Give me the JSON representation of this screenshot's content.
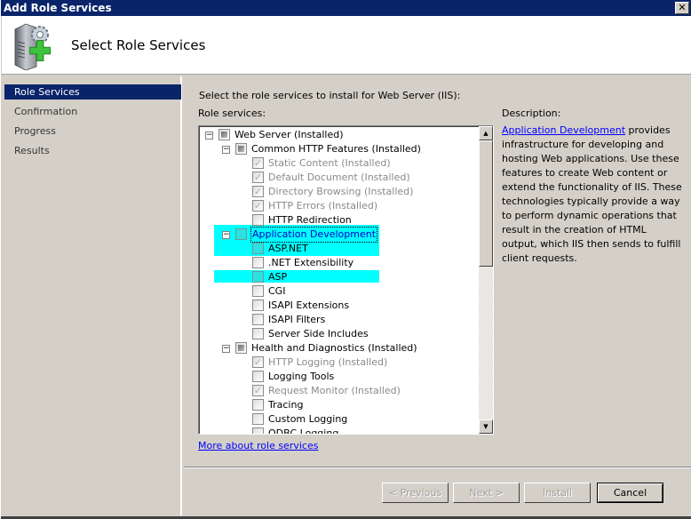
{
  "window": {
    "title": "Add Role Services",
    "close_icon": "close-x-icon"
  },
  "header": {
    "title": "Select Role Services",
    "icon": "server-add-icon"
  },
  "sidebar": {
    "items": [
      {
        "label": "Role Services",
        "active": true
      },
      {
        "label": "Confirmation",
        "active": false
      },
      {
        "label": "Progress",
        "active": false
      },
      {
        "label": "Results",
        "active": false
      }
    ]
  },
  "main": {
    "instruction": "Select the role services to install for Web Server (IIS):",
    "role_services_label": "Role services:",
    "tree": [
      {
        "label": "Web Server  (Installed)",
        "level": 0,
        "expander": "minus",
        "state": "indeterminate",
        "gray": false
      },
      {
        "label": "Common HTTP Features  (Installed)",
        "level": 1,
        "expander": "minus",
        "state": "indeterminate",
        "gray": false
      },
      {
        "label": "Static Content  (Installed)",
        "level": 2,
        "state": "checked",
        "gray": true
      },
      {
        "label": "Default Document  (Installed)",
        "level": 2,
        "state": "checked",
        "gray": true
      },
      {
        "label": "Directory Browsing  (Installed)",
        "level": 2,
        "state": "checked",
        "gray": true
      },
      {
        "label": "HTTP Errors  (Installed)",
        "level": 2,
        "state": "checked",
        "gray": true
      },
      {
        "label": "HTTP Redirection",
        "level": 2,
        "state": "unchecked",
        "gray": false
      },
      {
        "label": "Application Development",
        "level": 1,
        "expander": "minus",
        "state": "unchecked",
        "gray": false,
        "selected": true
      },
      {
        "label": "ASP.NET",
        "level": 2,
        "state": "unchecked",
        "gray": false,
        "highlight": true
      },
      {
        "label": ".NET Extensibility",
        "level": 2,
        "state": "unchecked",
        "gray": false
      },
      {
        "label": "ASP",
        "level": 2,
        "state": "unchecked",
        "gray": false,
        "highlight": true
      },
      {
        "label": "CGI",
        "level": 2,
        "state": "unchecked",
        "gray": false
      },
      {
        "label": "ISAPI Extensions",
        "level": 2,
        "state": "unchecked",
        "gray": false
      },
      {
        "label": "ISAPI Filters",
        "level": 2,
        "state": "unchecked",
        "gray": false
      },
      {
        "label": "Server Side Includes",
        "level": 2,
        "state": "unchecked",
        "gray": false
      },
      {
        "label": "Health and Diagnostics  (Installed)",
        "level": 1,
        "expander": "minus",
        "state": "indeterminate",
        "gray": false
      },
      {
        "label": "HTTP Logging  (Installed)",
        "level": 2,
        "state": "checked",
        "gray": true
      },
      {
        "label": "Logging Tools",
        "level": 2,
        "state": "unchecked",
        "gray": false
      },
      {
        "label": "Request Monitor  (Installed)",
        "level": 2,
        "state": "checked",
        "gray": true
      },
      {
        "label": "Tracing",
        "level": 2,
        "state": "unchecked",
        "gray": false
      },
      {
        "label": "Custom Logging",
        "level": 2,
        "state": "unchecked",
        "gray": false
      },
      {
        "label": "ODBC Logging",
        "level": 2,
        "state": "unchecked",
        "gray": false
      }
    ],
    "description_label": "Description:",
    "description_link": "Application Development",
    "description_text": " provides infrastructure for developing and hosting Web applications. Use these features to create Web content or extend the functionality of IIS. These technologies typically provide a way to perform dynamic operations that result in the creation of HTML output, which IIS then sends to fulfill client requests.",
    "more_link": "More about role services"
  },
  "footer": {
    "previous": "< Previous",
    "next": "Next >",
    "install": "Install",
    "cancel": "Cancel"
  },
  "colors": {
    "titlebar": "#0a246a",
    "highlight": "#00ffff",
    "link": "#0000ff"
  }
}
